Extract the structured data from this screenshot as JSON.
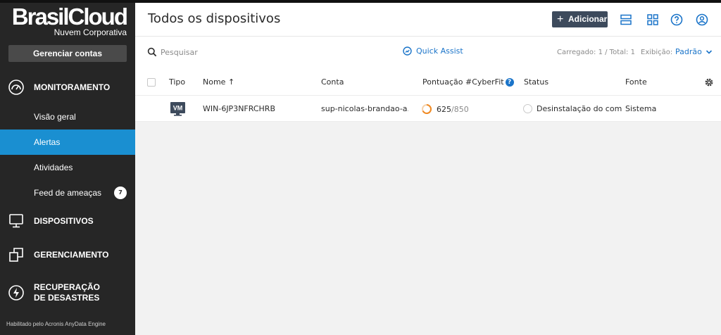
{
  "brand": {
    "name": "BrasilCloud",
    "subtitle": "Nuvem Corporativa"
  },
  "sidebar": {
    "manage_button": "Gerenciar contas",
    "sections": [
      {
        "label": "MONITORAMENTO",
        "icon": "gauge-icon"
      },
      {
        "label": "DISPOSITIVOS",
        "icon": "monitor-icon"
      },
      {
        "label": "GERENCIAMENTO",
        "icon": "copy-icon"
      },
      {
        "label": "RECUPERAÇÃO DE DESASTRES",
        "icon": "lightning-icon"
      }
    ],
    "items": [
      {
        "label": "Visão geral",
        "active": false
      },
      {
        "label": "Alertas",
        "active": true
      },
      {
        "label": "Atividades",
        "active": false
      },
      {
        "label": "Feed de ameaças",
        "active": false,
        "badge": "7"
      }
    ],
    "engine_text": "Habilitado pelo Acronis AnyData Engine"
  },
  "header": {
    "title": "Todos os dispositivos",
    "add_button": "Adicionar",
    "icons": [
      "list-view-icon",
      "grid-view-icon",
      "help-icon",
      "user-icon"
    ]
  },
  "toolbar": {
    "search_placeholder": "Pesquisar",
    "quick_assist": "Quick Assist",
    "loaded_text": "Carregado: 1 / Total: 1",
    "view_label": "Exibição:",
    "view_value": "Padrão"
  },
  "table": {
    "columns": {
      "type": "Tipo",
      "name": "Nome ↑",
      "account": "Conta",
      "cyberfit": "Pontuação #CyberFit",
      "status": "Status",
      "source": "Fonte"
    },
    "rows": [
      {
        "type": "VM",
        "name": "WIN-6JP3NFRCHRB",
        "account": "sup-nicolas-brandao-a...",
        "score": "625",
        "score_max": "/850",
        "status": "Desinstalação do comp",
        "source": "Sistema"
      }
    ]
  },
  "colors": {
    "accent": "#1a8fd1",
    "link": "#1a74c9",
    "sidebar": "#262626",
    "add_button": "#3d4a5c",
    "score_ring": "#f08a24"
  }
}
